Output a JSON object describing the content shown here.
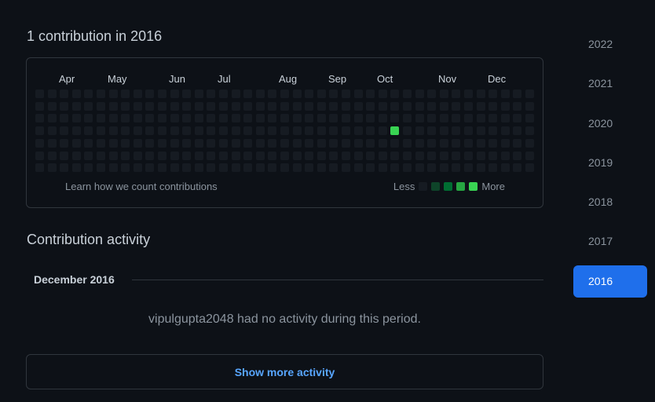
{
  "contributions": {
    "heading": "1 contribution in 2016",
    "months": [
      "Apr",
      "May",
      "Jun",
      "Jul",
      "Aug",
      "Sep",
      "Oct",
      "Nov",
      "Dec"
    ],
    "weeks": 41,
    "days_per_week": 7,
    "active_cells": [
      {
        "week": 29,
        "day": 3,
        "level": 4
      }
    ],
    "learn_link": "Learn how we count contributions",
    "legend": {
      "less": "Less",
      "more": "More",
      "levels": [
        "#161b22",
        "#0e4429",
        "#006d32",
        "#26a641",
        "#39d353"
      ]
    }
  },
  "years": {
    "items": [
      "2022",
      "2021",
      "2020",
      "2019",
      "2018",
      "2017",
      "2016"
    ],
    "selected": "2016"
  },
  "activity": {
    "heading": "Contribution activity",
    "month_label": "December 2016",
    "no_activity": "vipulgupta2048 had no activity during this period.",
    "show_more": "Show more activity"
  },
  "colors": {
    "background": "#0d1117",
    "border": "#30363d",
    "accent": "#1f6feb",
    "link": "#58a6ff",
    "empty_cell": "#161b22",
    "active_cell": "#39d353"
  }
}
